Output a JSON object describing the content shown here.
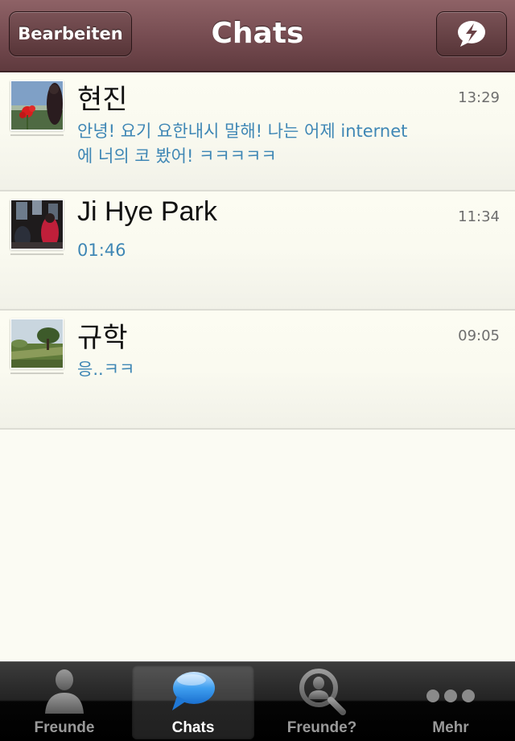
{
  "header": {
    "title": "Chats",
    "edit_label": "Bearbeiten",
    "compose_icon": "lightning-bubble-icon"
  },
  "chats": [
    {
      "name": "현진",
      "time": "13:29",
      "message": "안녕! 요기 요한내시 말해! 나는 어제 internet 에 너의 코 봤어! ㅋㅋㅋㅋㅋ"
    },
    {
      "name": "Ji Hye Park",
      "time": "11:34",
      "message": "01:46"
    },
    {
      "name": "규학",
      "time": "09:05",
      "message": "응..ㅋㅋ"
    }
  ],
  "tabbar": {
    "tabs": [
      {
        "label": "Freunde",
        "icon": "person-icon",
        "selected": false
      },
      {
        "label": "Chats",
        "icon": "chat-bubble-icon",
        "selected": true
      },
      {
        "label": "Freunde?",
        "icon": "search-person-icon",
        "selected": false
      },
      {
        "label": "Mehr",
        "icon": "more-dots-icon",
        "selected": false
      }
    ]
  },
  "colors": {
    "navbar": "#754b50",
    "message_text": "#3f87b5",
    "list_background": "#fbfbf3"
  }
}
